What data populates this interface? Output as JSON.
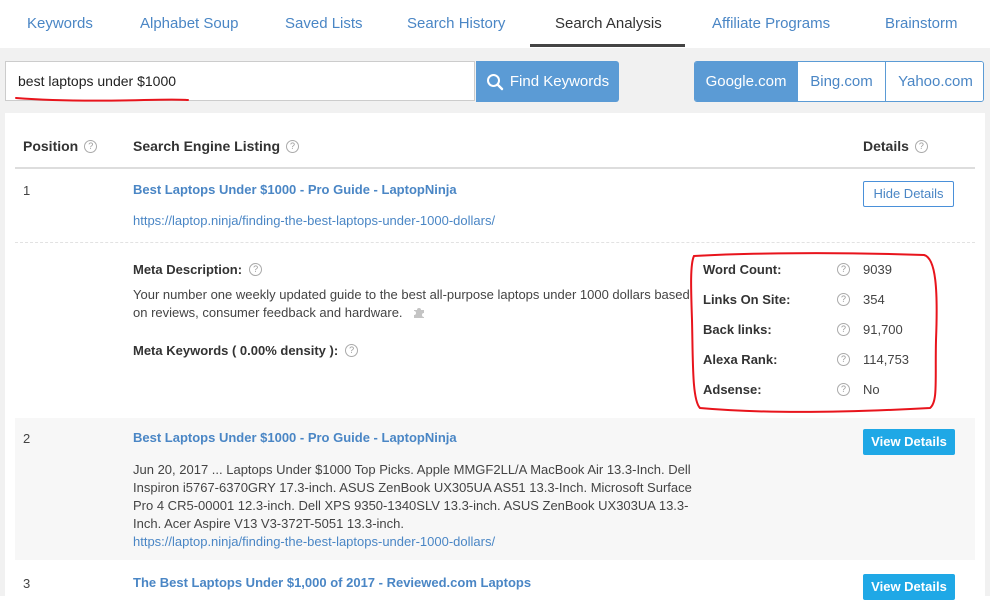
{
  "nav": {
    "tabs": [
      "Keywords",
      "Alphabet Soup",
      "Saved Lists",
      "Search History",
      "Search Analysis",
      "Affiliate Programs",
      "Brainstorm"
    ],
    "active_tab": "Search Analysis"
  },
  "search": {
    "value": "best laptops under $1000",
    "button_label": "Find Keywords"
  },
  "engines": {
    "items": [
      "Google.com",
      "Bing.com",
      "Yahoo.com"
    ],
    "active": "Google.com"
  },
  "table": {
    "headers": {
      "position": "Position",
      "listing": "Search Engine Listing",
      "details": "Details"
    },
    "help_glyph": "?"
  },
  "results": [
    {
      "position": "1",
      "title": "Best Laptops Under $1000 - Pro Guide - LaptopNinja",
      "url": "https://laptop.ninja/finding-the-best-laptops-under-1000-dollars/",
      "button": "Hide Details",
      "meta_description_label": "Meta Description:",
      "meta_description": "Your number one weekly updated guide to the best all-purpose laptops under 1000 dollars based on reviews, consumer feedback and hardware.",
      "meta_keywords_label": "Meta Keywords ( 0.00% density ):",
      "stats": [
        {
          "label": "Word Count:",
          "value": "9039"
        },
        {
          "label": "Links On Site:",
          "value": "354"
        },
        {
          "label": "Back links:",
          "value": "91,700"
        },
        {
          "label": "Alexa Rank:",
          "value": "114,753"
        },
        {
          "label": "Adsense:",
          "value": "No"
        }
      ]
    },
    {
      "position": "2",
      "title": "Best Laptops Under $1000 - Pro Guide - LaptopNinja",
      "snippet": "Jun 20, 2017 ... Laptops Under $1000 Top Picks. Apple MMGF2LL/A MacBook Air 13.3-Inch. Dell Inspiron i5767-6370GRY 17.3-inch. ASUS ZenBook UX305UA AS51 13.3-Inch. Microsoft Surface Pro 4 CR5-00001 12.3-inch. Dell XPS 9350-1340SLV 13.3-inch. ASUS ZenBook UX303UA 13.3-Inch. Acer Aspire V13 V3-372T-5051 13.3-inch.",
      "url": "https://laptop.ninja/finding-the-best-laptops-under-1000-dollars/",
      "button": "View Details"
    },
    {
      "position": "3",
      "title": "The Best Laptops Under $1,000 of 2017 - Reviewed.com Laptops",
      "button": "View Details"
    }
  ],
  "colors": {
    "link": "#4a86c5",
    "accent": "#5b9bd5",
    "view_button": "#1fa8e6",
    "annotation_red": "#e8141c"
  }
}
